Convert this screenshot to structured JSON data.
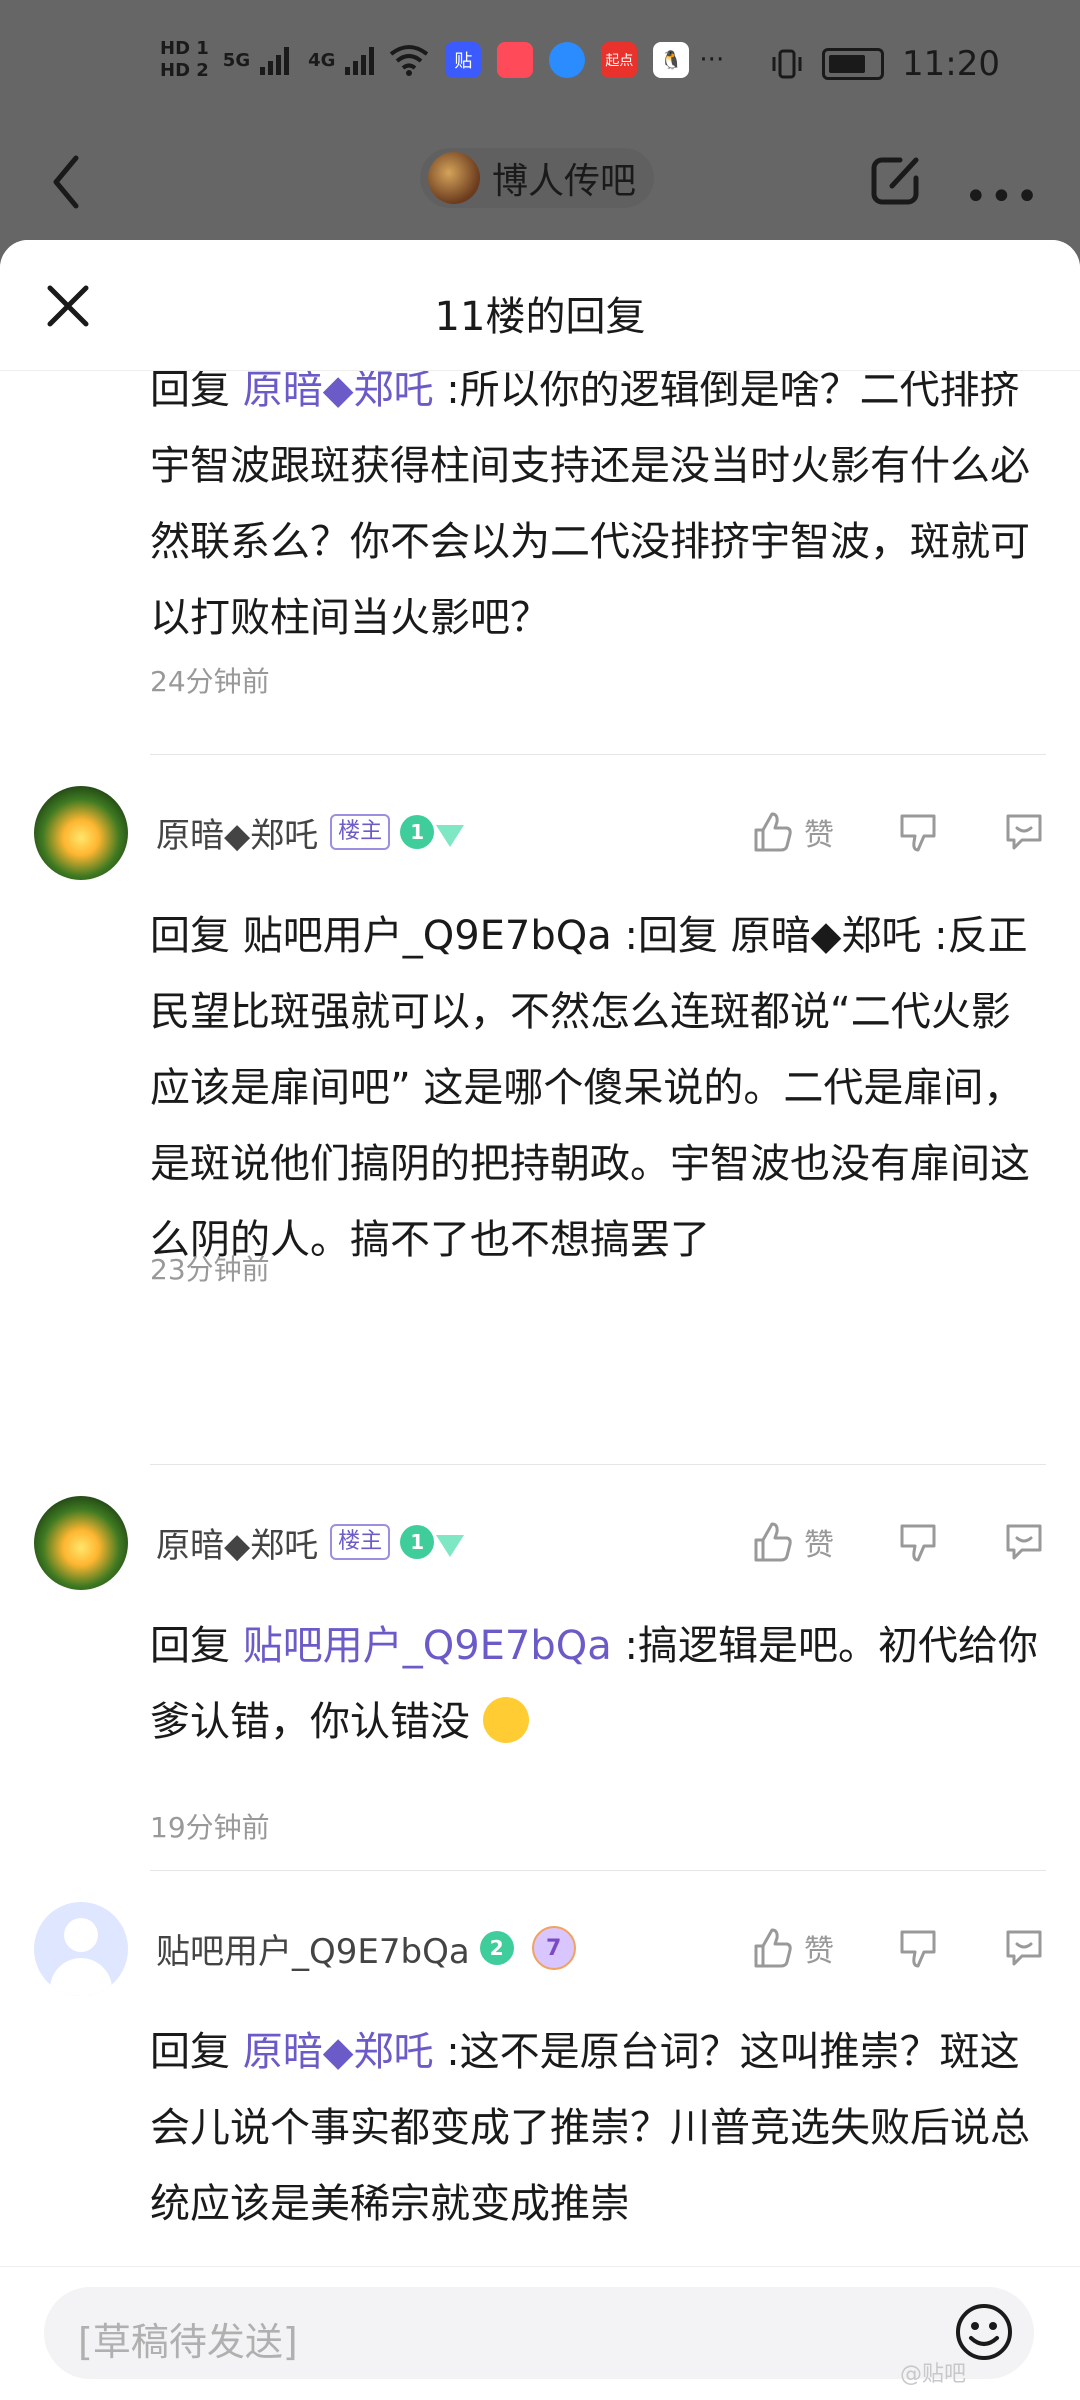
{
  "status_bar": {
    "hd1": "HD 1",
    "hd2": "HD 2",
    "net1": "5G",
    "net2": "4G",
    "time": "11:20",
    "apps": [
      "贴",
      "",
      "",
      "起点",
      ""
    ]
  },
  "nav": {
    "forum_name": "博人传吧"
  },
  "sheet": {
    "title": "11楼的回复"
  },
  "replies": [
    {
      "text_prefix": "回复 ",
      "mention": "原暗◆郑吒",
      "text": " :所以你的逻辑倒是啥？二代排挤宇智波跟斑获得柱间支持还是没当时火影有什么必然联系么？你不会以为二代没排挤宇智波，斑就可以打败柱间当火影吧？",
      "time": "24分钟前"
    },
    {
      "username": "原暗◆郑吒",
      "owner_badge": "楼主",
      "level": "1",
      "like_label": "赞",
      "text": "回复 贴吧用户_Q9E7bQa :回复 原暗◆郑吒 :反正民望比斑强就可以，不然怎么连斑都说“二代火影应该是扉间吧” 这是哪个傻呆说的。二代是扉间，是斑说他们搞阴的把持朝政。宇智波也没有扉间这么阴的人。搞不了也不想搞罢了",
      "time": "23分钟前"
    },
    {
      "username": "原暗◆郑吒",
      "owner_badge": "楼主",
      "level": "1",
      "like_label": "赞",
      "text_prefix": "回复 ",
      "mention": "贴吧用户_Q9E7bQa",
      "text": " :搞逻辑是吧。初代给你爹认错，你认错没 ",
      "time": "19分钟前"
    },
    {
      "username": "贴吧用户_Q9E7bQa",
      "level": "2",
      "level2": "7",
      "like_label": "赞",
      "text_prefix": "回复 ",
      "mention": "原暗◆郑吒",
      "text": " :这不是原台词？这叫推崇？斑这会儿说个事实都变成了推崇？川普竞选失败后说总统应该是美稀宗就变成推崇"
    }
  ],
  "input": {
    "placeholder": "[草稿待发送]"
  },
  "watermark": "@贴吧"
}
